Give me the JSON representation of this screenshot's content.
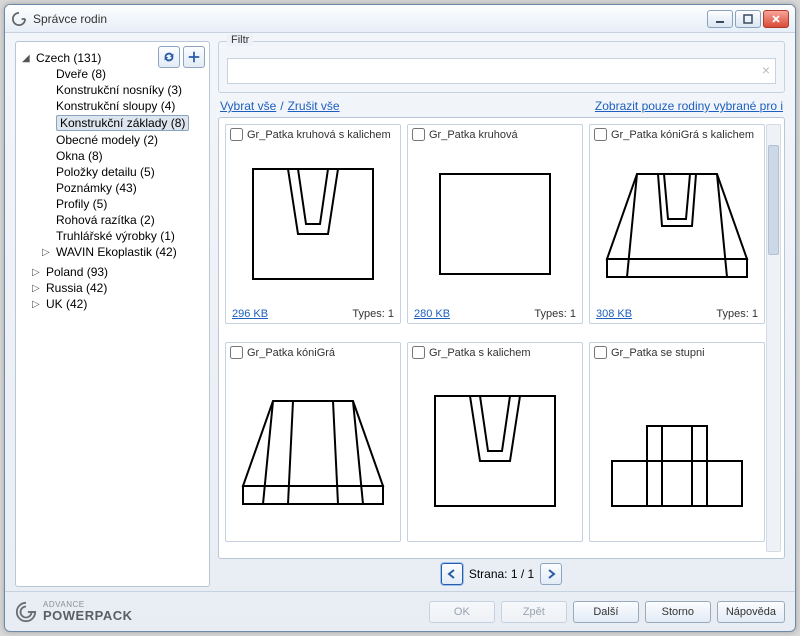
{
  "titlebar": {
    "title": "Správce rodin"
  },
  "tree": {
    "top": {
      "label": "Czech (131)",
      "expanded": true
    },
    "children": [
      {
        "label": "Dveře (8)"
      },
      {
        "label": "Konstrukční nosníky (3)"
      },
      {
        "label": "Konstrukční sloupy (4)"
      },
      {
        "label": "Konstrukční základy (8)",
        "selected": true
      },
      {
        "label": "Obecné modely (2)"
      },
      {
        "label": "Okna (8)"
      },
      {
        "label": "Položky detailu (5)"
      },
      {
        "label": "Poznámky (43)"
      },
      {
        "label": "Profily (5)"
      },
      {
        "label": "Rohová razítka (2)"
      },
      {
        "label": "Truhlářské výrobky (1)"
      },
      {
        "label": "WAVIN Ekoplastik (42)",
        "caret": "▷"
      }
    ],
    "siblings": [
      {
        "label": "Poland (93)",
        "caret": "▷"
      },
      {
        "label": "Russia (42)",
        "caret": "▷"
      },
      {
        "label": "UK (42)",
        "caret": "▷"
      }
    ]
  },
  "filter": {
    "legend": "Filtr",
    "value": ""
  },
  "links": {
    "select_all": "Vybrat vše",
    "deselect_all": "Zrušit vše",
    "show_selected": "Zobrazit pouze rodiny vybrané pro i"
  },
  "pager": {
    "label": "Strana: 1 / 1"
  },
  "types_label": "Types:",
  "tiles": [
    {
      "name": "Gr_Patka kruhová s kalichem",
      "size": "296 KB",
      "types": "1",
      "shape": "kalich"
    },
    {
      "name": "Gr_Patka kruhová",
      "size": "280 KB",
      "types": "1",
      "shape": "block"
    },
    {
      "name": "Gr_Patka kóniGrá s kalichem",
      "size": "308 KB",
      "types": "1",
      "shape": "trapez_slot"
    },
    {
      "name": "Gr_Patka kóniGrá",
      "size": "",
      "types": "",
      "shape": "trapez"
    },
    {
      "name": "Gr_Patka s kalichem",
      "size": "",
      "types": "",
      "shape": "kalich"
    },
    {
      "name": "Gr_Patka se stupni",
      "size": "",
      "types": "",
      "shape": "step"
    }
  ],
  "footer": {
    "ok": "OK",
    "back": "Zpět",
    "next": "Další",
    "cancel": "Storno",
    "help": "Nápověda",
    "brand_top": "ADVANCE",
    "brand_bottom": "POWERPACK"
  }
}
